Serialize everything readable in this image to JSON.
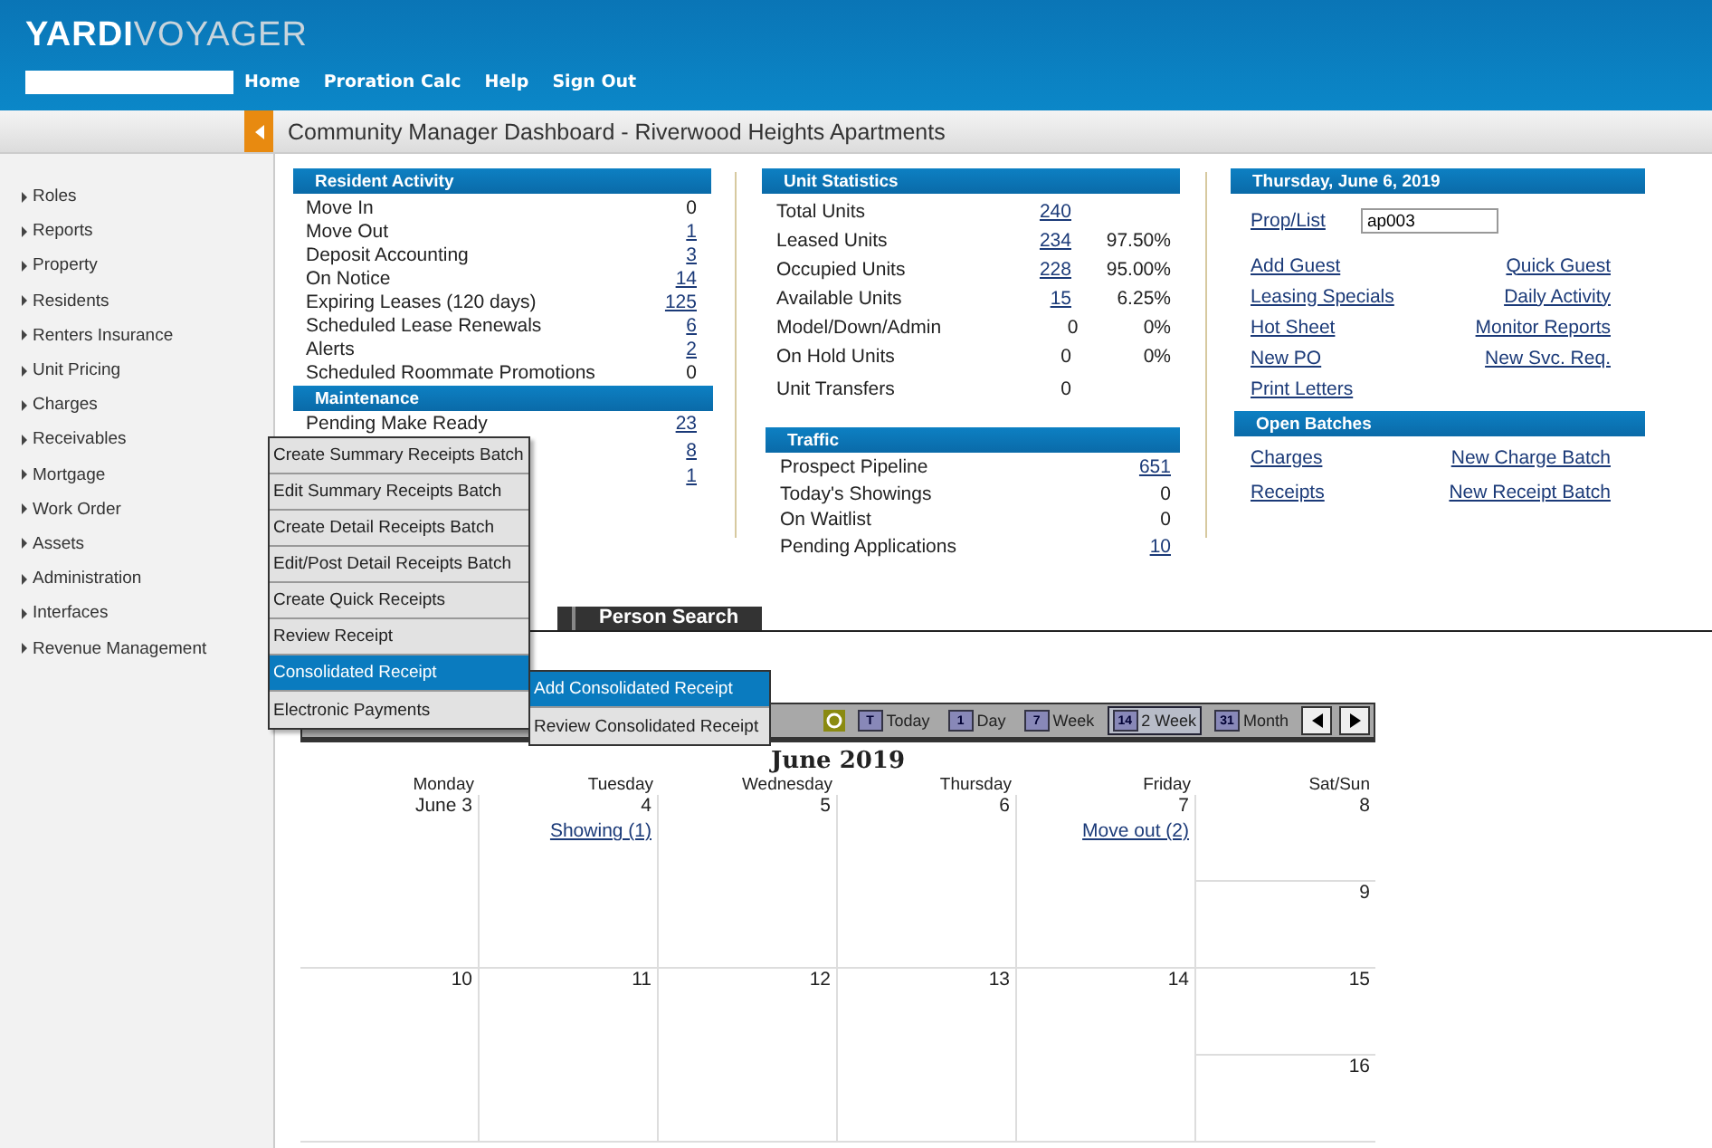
{
  "header": {
    "logo_bold": "YARDI",
    "logo_light": "VOYAGER",
    "nav": [
      "Home",
      "Proration Calc",
      "Help",
      "Sign Out"
    ]
  },
  "page_title": "Community Manager Dashboard - Riverwood Heights Apartments",
  "sidebar": {
    "items": [
      "Roles",
      "Reports",
      "Property",
      "Residents",
      "Renters Insurance",
      "Unit Pricing",
      "Charges",
      "Receivables",
      "Mortgage",
      "Work Order",
      "Assets",
      "Administration",
      "Interfaces",
      "Revenue Management"
    ]
  },
  "resident_activity": {
    "title": "Resident Activity",
    "rows": [
      {
        "label": "Move In",
        "value": "0",
        "link": false
      },
      {
        "label": "Move Out",
        "value": "1",
        "link": true
      },
      {
        "label": "Deposit Accounting",
        "value": "3",
        "link": true
      },
      {
        "label": "On Notice",
        "value": "14",
        "link": true
      },
      {
        "label": "Expiring Leases (120 days)",
        "value": "125",
        "link": true
      },
      {
        "label": "Scheduled Lease Renewals",
        "value": "6",
        "link": true
      },
      {
        "label": "Alerts",
        "value": "2",
        "link": true
      },
      {
        "label": "Scheduled Roommate Promotions",
        "value": "0",
        "link": false
      }
    ]
  },
  "maintenance": {
    "title": "Maintenance",
    "rows": [
      {
        "label": "Pending Make Ready",
        "value": "23",
        "link": true
      },
      {
        "value": "8",
        "link": true
      },
      {
        "value": "1",
        "link": true
      }
    ]
  },
  "unit_statistics": {
    "title": "Unit Statistics",
    "rows": [
      {
        "label": "Total Units",
        "value": "240",
        "link": true
      },
      {
        "label": "Leased Units",
        "value": "234",
        "link": true,
        "percent": "97.50%"
      },
      {
        "label": "Occupied Units",
        "value": "228",
        "link": true,
        "percent": "95.00%"
      },
      {
        "label": "Available Units",
        "value": "15",
        "link": true,
        "percent": "6.25%"
      },
      {
        "label": "Model/Down/Admin",
        "value": "0",
        "link": false,
        "percent": "0%"
      },
      {
        "label": "On Hold Units",
        "value": "0",
        "link": false,
        "percent": "0%"
      },
      {
        "label": "Unit Transfers",
        "value": "0",
        "link": false
      }
    ]
  },
  "traffic": {
    "title": "Traffic",
    "rows": [
      {
        "label": "Prospect Pipeline",
        "value": "651",
        "link": true
      },
      {
        "label": "Today's Showings",
        "value": "0",
        "link": false
      },
      {
        "label": "On Waitlist",
        "value": "0",
        "link": false
      },
      {
        "label": "Pending Applications",
        "value": "10",
        "link": true
      }
    ]
  },
  "today": {
    "title": "Thursday, June 6, 2019",
    "prop_label": "Prop/List",
    "prop_value": "ap003",
    "links": [
      [
        "Add Guest",
        "Quick Guest"
      ],
      [
        "Leasing Specials",
        "Daily Activity"
      ],
      [
        "Hot Sheet",
        "Monitor Reports"
      ],
      [
        "New PO",
        "New Svc. Req."
      ],
      [
        "Print Letters"
      ]
    ]
  },
  "open_batches": {
    "title": "Open Batches",
    "links": [
      [
        "Charges",
        "New Charge Batch"
      ],
      [
        "Receipts",
        "New Receipt Batch"
      ]
    ]
  },
  "tabs": [
    "Person Search"
  ],
  "calendar": {
    "title": "June 2019",
    "views": [
      {
        "label": "Today",
        "icon": "T",
        "selected": false
      },
      {
        "label": "Day",
        "icon": "1",
        "selected": false
      },
      {
        "label": "Week",
        "icon": "7",
        "selected": false
      },
      {
        "label": "2 Week",
        "icon": "14",
        "selected": true
      },
      {
        "label": "Month",
        "icon": "31",
        "selected": false
      }
    ],
    "days": [
      "Monday",
      "Tuesday",
      "Wednesday",
      "Thursday",
      "Friday",
      "Sat/Sun"
    ],
    "weeks": [
      {
        "cells": [
          {
            "date": "June 3"
          },
          {
            "date": "4",
            "event": "Showing (1)"
          },
          {
            "date": "5"
          },
          {
            "date": "6"
          },
          {
            "date": "7",
            "event": "Move out (2)"
          }
        ],
        "weekend": [
          "8",
          "9"
        ]
      },
      {
        "cells": [
          {
            "date": "10"
          },
          {
            "date": "11"
          },
          {
            "date": "12"
          },
          {
            "date": "13"
          },
          {
            "date": "14"
          }
        ],
        "weekend": [
          "15",
          "16"
        ]
      }
    ]
  },
  "menu": {
    "items": [
      {
        "label": "Create Summary Receipts Batch",
        "selected": false
      },
      {
        "label": "Edit Summary Receipts Batch",
        "selected": false
      },
      {
        "label": "Create Detail Receipts Batch",
        "selected": false
      },
      {
        "label": "Edit/Post Detail Receipts Batch",
        "selected": false
      },
      {
        "label": "Create Quick Receipts",
        "selected": false
      },
      {
        "label": "Review Receipt",
        "selected": false
      },
      {
        "label": "Consolidated Receipt",
        "selected": true
      },
      {
        "label": "Electronic Payments",
        "selected": false
      }
    ]
  },
  "submenu": {
    "items": [
      {
        "label": "Add Consolidated Receipt",
        "selected": true
      },
      {
        "label": "Review Consolidated Receipt",
        "selected": false
      }
    ]
  }
}
